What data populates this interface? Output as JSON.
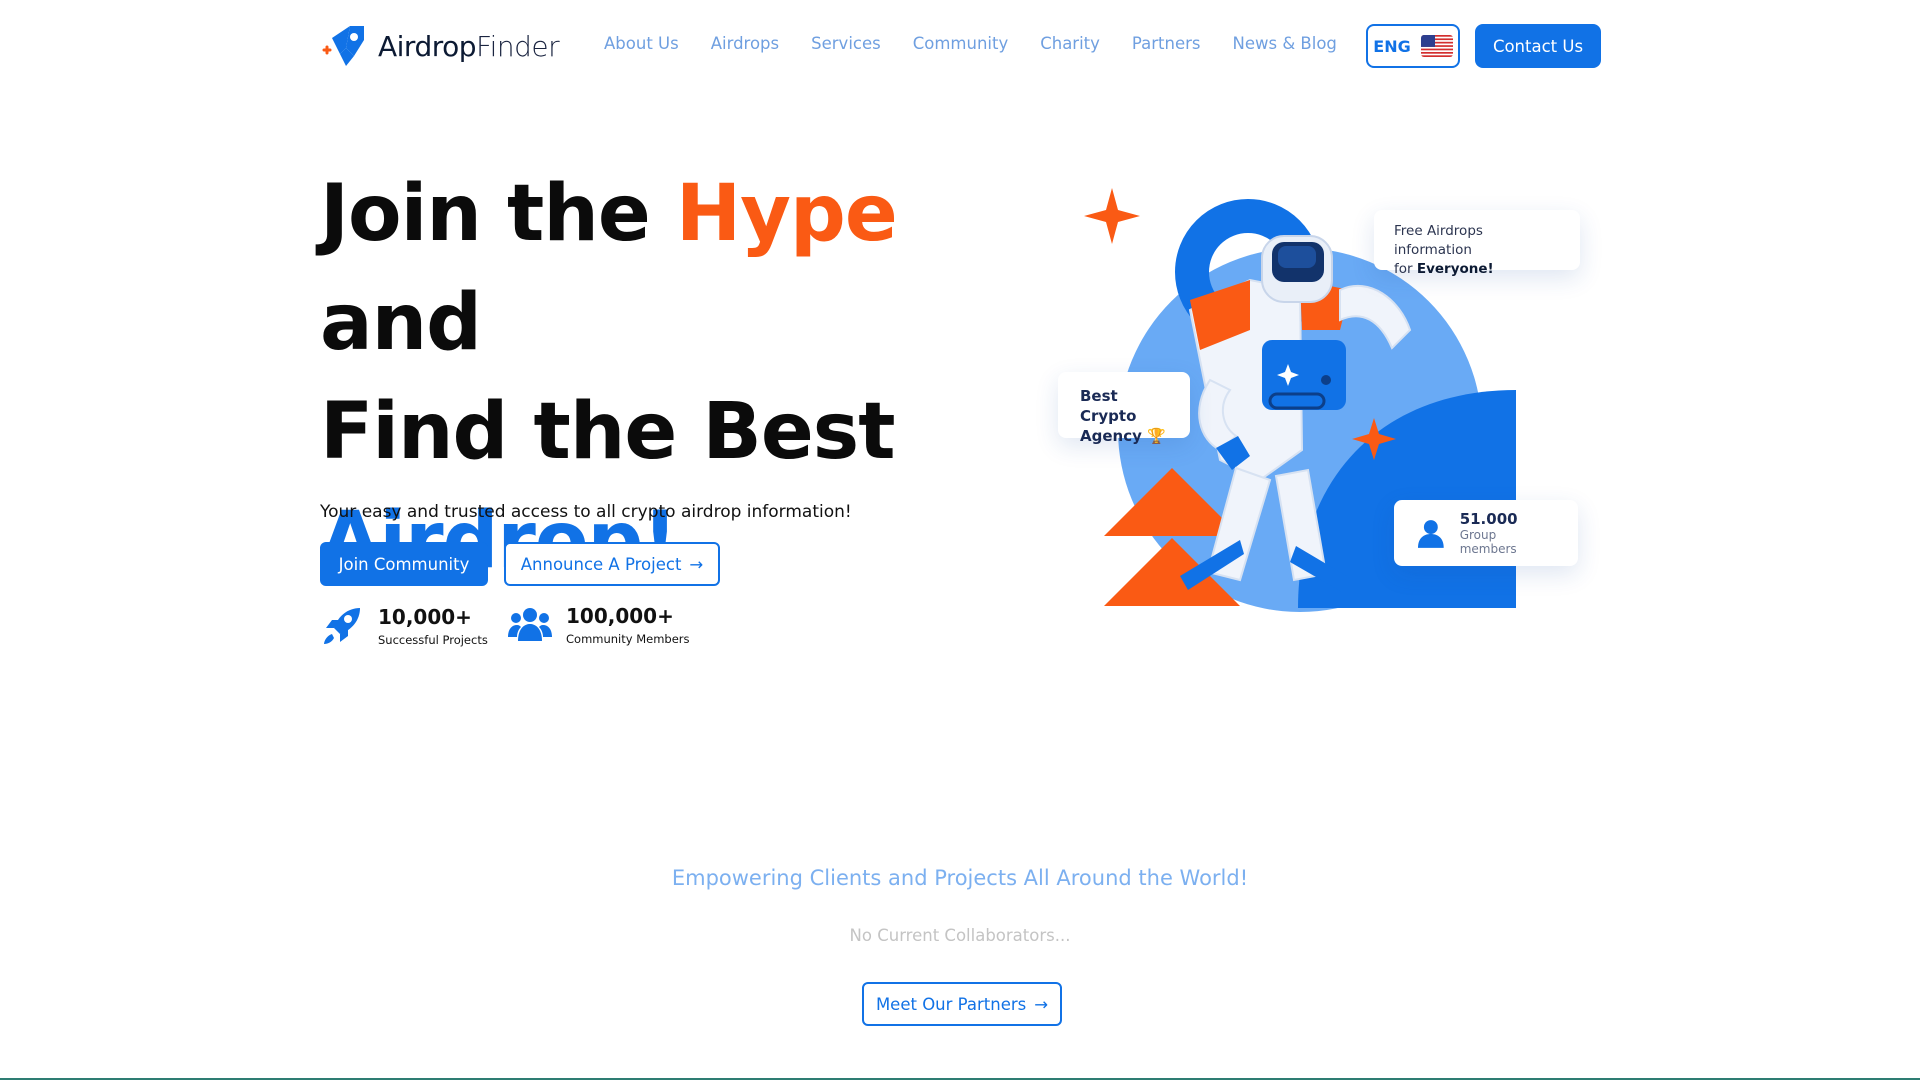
{
  "nav": {
    "logo_bold": "Airdrop",
    "logo_light": "Finder",
    "items": [
      "About Us",
      "Airdrops",
      "Services",
      "Community",
      "Charity",
      "Partners",
      "News & Blog"
    ],
    "lang": "ENG",
    "contact": "Contact Us"
  },
  "hero": {
    "line1_a": "Join the ",
    "line1_b": "Hype",
    "line1_c": " and",
    "line2": "Find the Best",
    "line3": "Airdrop!",
    "subtitle": "Your easy and trusted access to all crypto airdrop information!",
    "primary_btn": "Join Community",
    "outline_btn": "Announce A Project",
    "stats": [
      {
        "value": "10,000+",
        "label": "Successful Projects",
        "icon": "rocket-icon"
      },
      {
        "value": "100,000+",
        "label": "Community Members",
        "icon": "users-icon"
      }
    ]
  },
  "illustration": {
    "free_line1": "Free Airdrops information",
    "free_line2_prefix": "for ",
    "free_line2_bold": "Everyone!",
    "best_line1": "Best Crypto",
    "best_line2": "Agency 🏆",
    "members_value": "51.000",
    "members_label": "Group members"
  },
  "partners": {
    "title": "Empowering Clients and Projects All Around the World!",
    "empty": "No Current Collaborators...",
    "button": "Meet Our Partners"
  },
  "colors": {
    "primary": "#1172e6",
    "accent": "#fa5a14",
    "nav_link": "#6f9fe0"
  }
}
